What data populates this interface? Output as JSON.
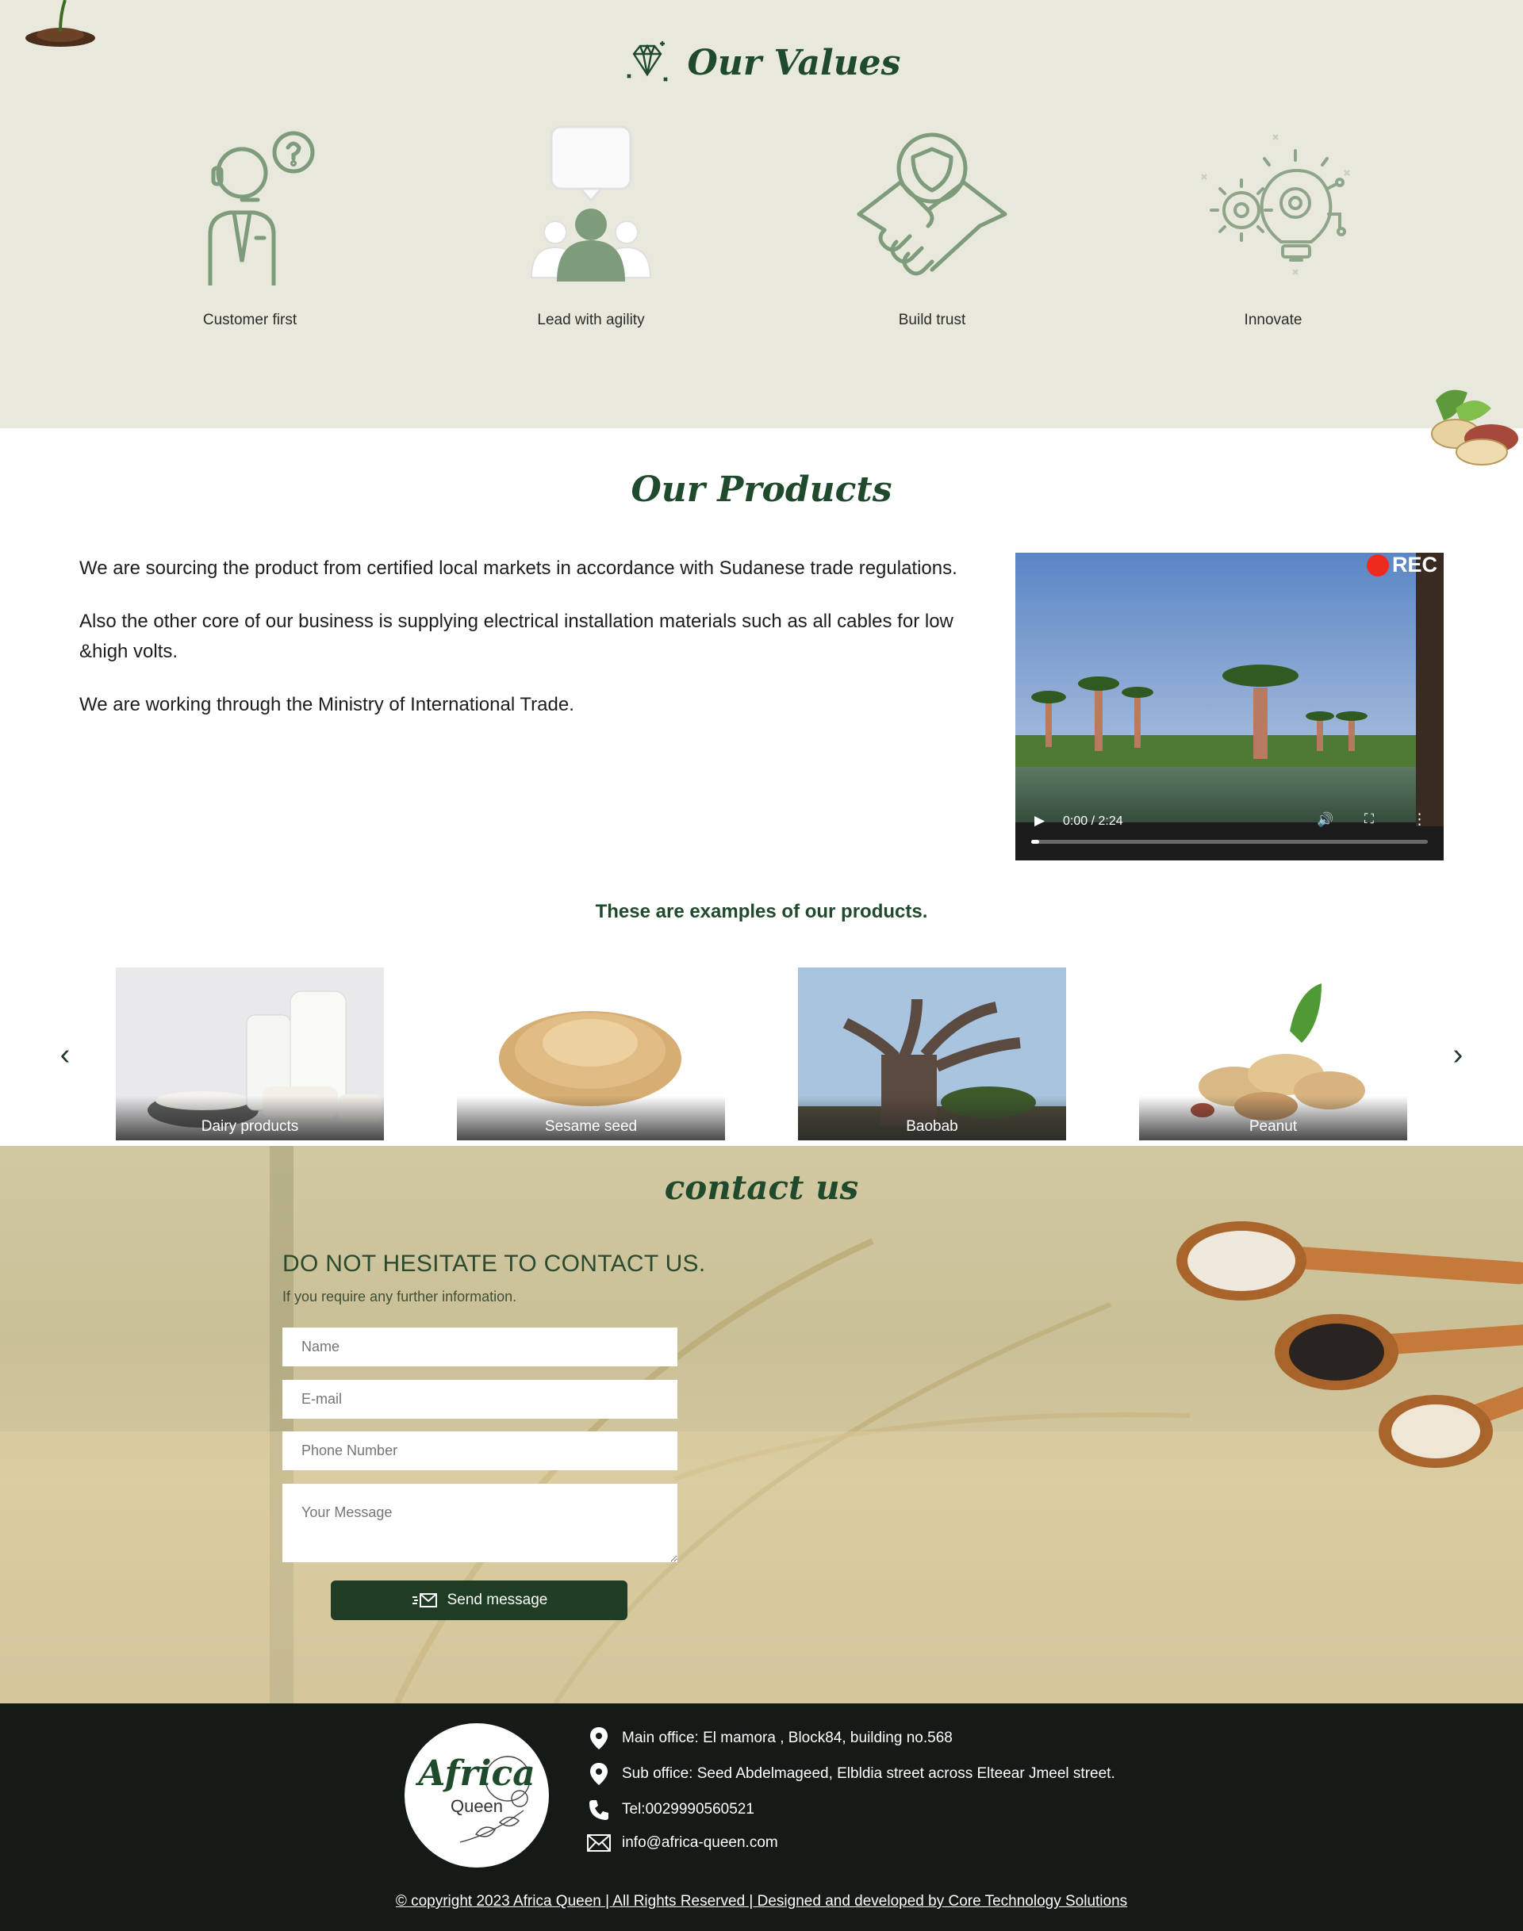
{
  "values": {
    "title": "Our Values",
    "items": [
      {
        "label": "Customer first",
        "icon": "customer-support-icon"
      },
      {
        "label": "Lead with agility",
        "icon": "leader-speech-icon"
      },
      {
        "label": "Build trust",
        "icon": "handshake-shield-icon"
      },
      {
        "label": "Innovate",
        "icon": "lightbulb-gear-icon"
      }
    ]
  },
  "products": {
    "title": "Our Products",
    "paragraphs": [
      "We are sourcing the product from certified local markets in accordance with Sudanese trade regulations.",
      "Also the other core of our business is supplying electrical installation materials such as all cables for low &high volts.",
      "We are working through the Ministry of International Trade."
    ],
    "video": {
      "badge": "REC",
      "time": "0:00 / 2:24",
      "progress": 0.02
    },
    "examples_label": "These are examples of our products.",
    "cards": [
      {
        "caption": "Dairy products"
      },
      {
        "caption": "Sesame seed"
      },
      {
        "caption": "Baobab"
      },
      {
        "caption": "Peanut"
      }
    ]
  },
  "contact": {
    "title": "contact us",
    "heading": "DO NOT HESITATE TO CONTACT US.",
    "sub": "If you require any further information.",
    "fields": {
      "name_placeholder": "Name",
      "email_placeholder": "E-mail",
      "phone_placeholder": "Phone Number",
      "message_placeholder": "Your Message"
    },
    "send_label": "Send message"
  },
  "footer": {
    "logo_word": "Africa",
    "logo_sub": "Queen",
    "main_office": "Main office: El mamora , Block84, building no.568",
    "sub_office": "Sub office: Seed Abdelmageed, Elbldia street across Elteear Jmeel street.",
    "tel": "Tel:0029990560521",
    "email": "info@africa-queen.com",
    "copyright": "© copyright 2023 Africa Queen | All Rights Reserved | Designed and developed by Core Technology Solutions"
  },
  "colors": {
    "brand_green": "#1f4a2c",
    "values_bg": "#e8e9dc",
    "footer_bg": "#141a16",
    "button_green": "#1f3d24"
  }
}
